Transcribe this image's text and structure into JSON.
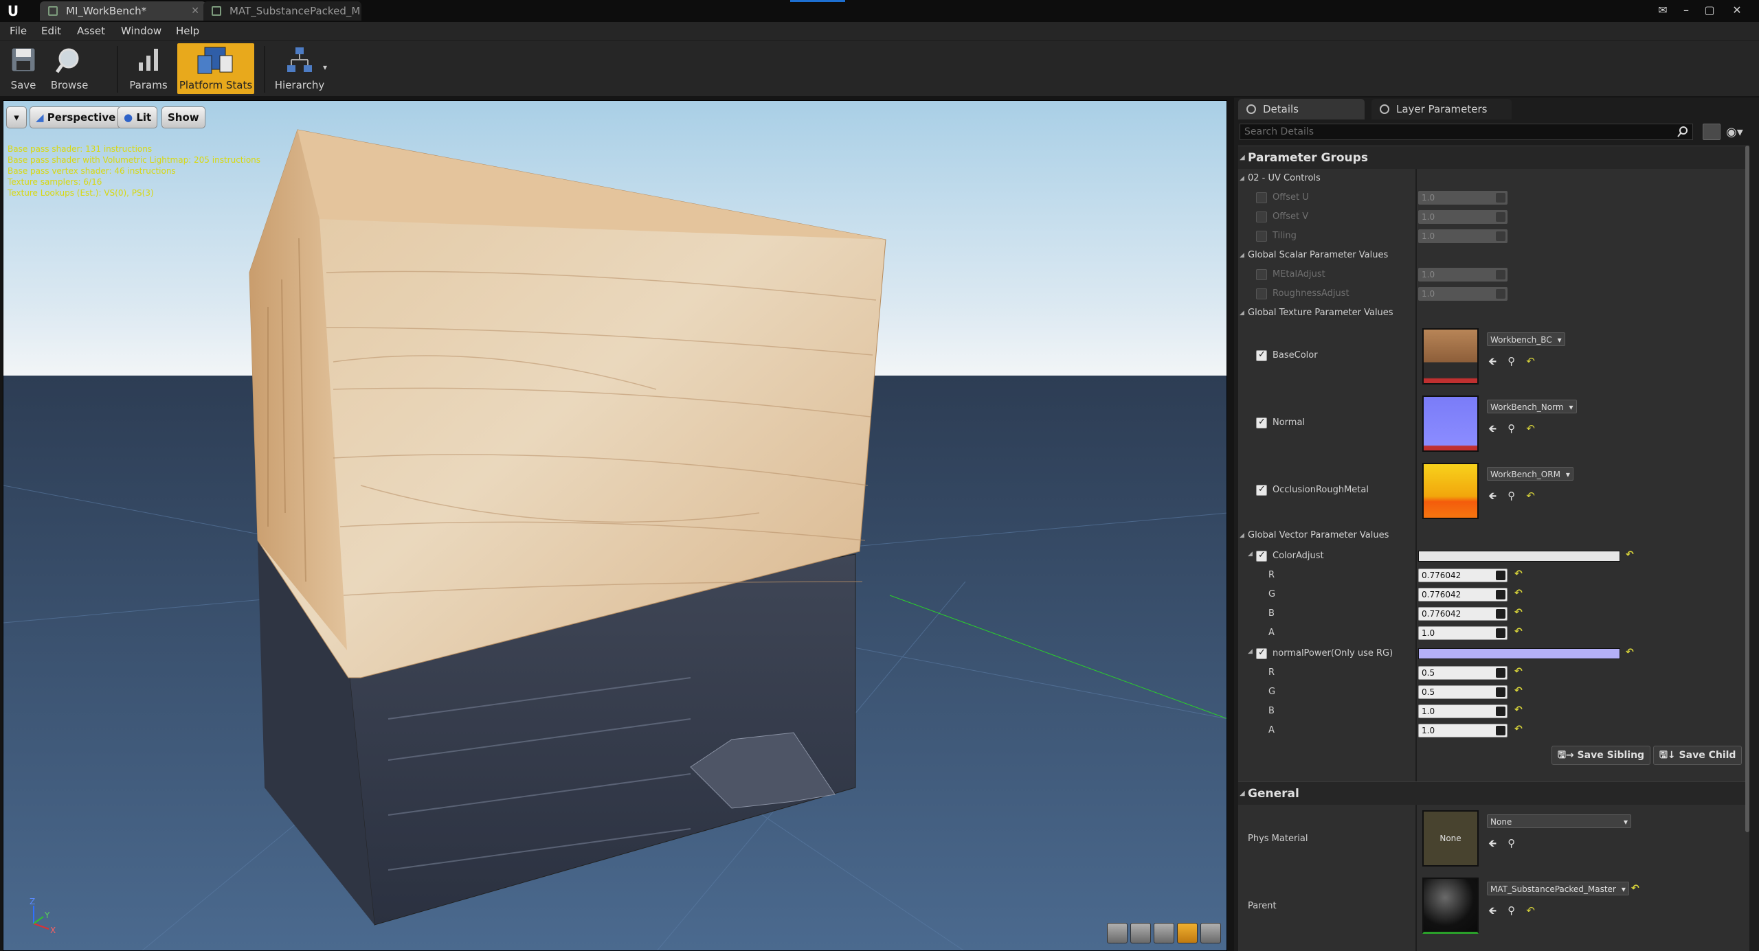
{
  "window": {
    "tabs": [
      {
        "label": "MI_WorkBench*"
      },
      {
        "label": "MAT_SubstancePacked_M"
      }
    ]
  },
  "menu": {
    "items": [
      "File",
      "Edit",
      "Asset",
      "Window",
      "Help"
    ]
  },
  "toolbar": {
    "save_label": "Save",
    "browse_label": "Browse",
    "params_label": "Params",
    "platform_stats_label": "Platform Stats",
    "hierarchy_label": "Hierarchy",
    "active_color": "#e8a91c"
  },
  "viewport": {
    "view_mode_label": "Perspective",
    "lit_label": "Lit",
    "show_label": "Show",
    "stats": [
      "Base pass shader: 131 instructions",
      "Base pass shader with Volumetric Lightmap: 205 instructions",
      "Base pass vertex shader: 46 instructions",
      "Texture samplers: 6/16",
      "Texture Lookups (Est.): VS(0), PS(3)"
    ],
    "stats_color": "#d8d80e",
    "axis_labels": {
      "x": "X",
      "y": "Y",
      "z": "Z"
    }
  },
  "details": {
    "tab_details": "Details",
    "tab_layer_params": "Layer Parameters",
    "search_placeholder": "Search Details",
    "parameter_groups_label": "Parameter Groups",
    "groups": {
      "uv": {
        "label": "02 - UV Controls",
        "params": [
          {
            "label": "Offset U",
            "value": "1.0"
          },
          {
            "label": "Offset V",
            "value": "1.0"
          },
          {
            "label": "Tiling",
            "value": "1.0"
          }
        ]
      },
      "scalar": {
        "label": "Global Scalar Parameter Values",
        "params": [
          {
            "label": "MEtalAdjust",
            "value": "1.0"
          },
          {
            "label": "RoughnessAdjust",
            "value": "1.0"
          }
        ]
      },
      "texture": {
        "label": "Global Texture Parameter Values",
        "params": [
          {
            "label": "BaseColor",
            "asset": "Workbench_BC"
          },
          {
            "label": "Normal",
            "asset": "WorkBench_Norm"
          },
          {
            "label": "OcclusionRoughMetal",
            "asset": "WorkBench_ORM"
          }
        ]
      },
      "vector": {
        "label": "Global Vector Parameter Values",
        "color_adjust": {
          "label": "ColorAdjust",
          "swatch": "#e6e6e6",
          "channels": [
            {
              "label": "R",
              "value": "0.776042"
            },
            {
              "label": "G",
              "value": "0.776042"
            },
            {
              "label": "B",
              "value": "0.776042"
            },
            {
              "label": "A",
              "value": "1.0"
            }
          ]
        },
        "normal_power": {
          "label": "normalPower(Only use RG)",
          "swatch": "#b4b0f8",
          "channels": [
            {
              "label": "R",
              "value": "0.5"
            },
            {
              "label": "G",
              "value": "0.5"
            },
            {
              "label": "B",
              "value": "1.0"
            },
            {
              "label": "A",
              "value": "1.0"
            }
          ]
        }
      }
    },
    "save_sibling_label": "Save Sibling",
    "save_child_label": "Save Child",
    "general_label": "General",
    "phys_material": {
      "label": "Phys Material",
      "thumb_text": "None",
      "value": "None"
    },
    "parent": {
      "label": "Parent",
      "value": "MAT_SubstancePacked_Master"
    }
  }
}
